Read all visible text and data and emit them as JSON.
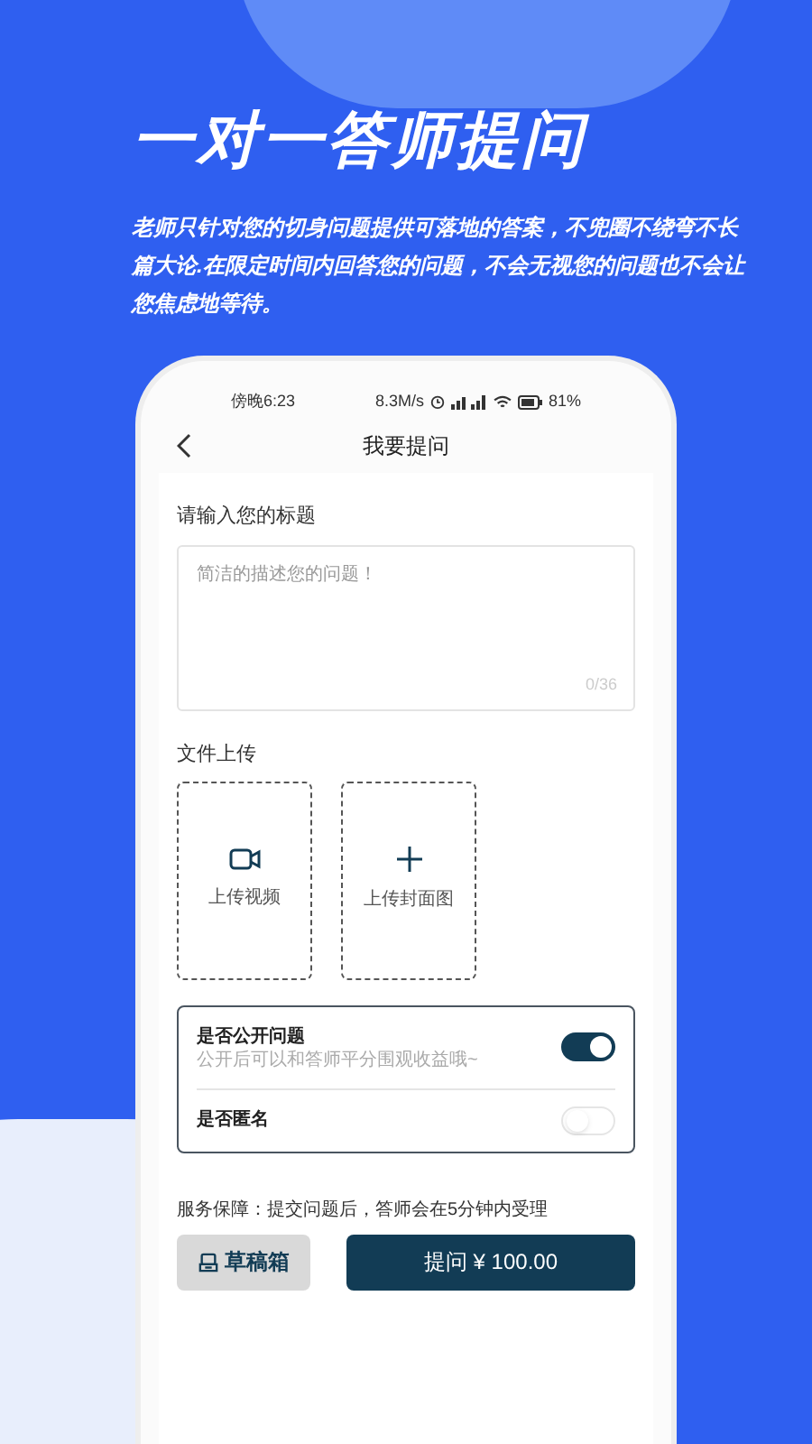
{
  "headline": "一对一答师提问",
  "intro": "老师只针对您的切身问题提供可落地的答案，不兜圈不绕弯不长篇大论.在限定时间内回答您的问题，不会无视您的问题也不会让您焦虑地等待。",
  "status_bar": {
    "time": "傍晚6:23",
    "speed": "8.3M/s",
    "battery": "81%"
  },
  "nav": {
    "title": "我要提问"
  },
  "title_field": {
    "label": "请输入您的标题",
    "placeholder": "简洁的描述您的问题！",
    "counter": "0/36"
  },
  "upload": {
    "label": "文件上传",
    "items": [
      {
        "kind": "video",
        "label": "上传视频"
      },
      {
        "kind": "image",
        "label": "上传封面图"
      }
    ]
  },
  "options": [
    {
      "label": "是否公开问题",
      "hint": "公开后可以和答师平分围观收益哦~",
      "on": true
    },
    {
      "label": "是否匿名",
      "on": false
    }
  ],
  "guarantee": "服务保障：提交问题后，答师会在5分钟内受理",
  "draft_button": "草稿箱",
  "submit_button": "提问 ¥ 100.00"
}
